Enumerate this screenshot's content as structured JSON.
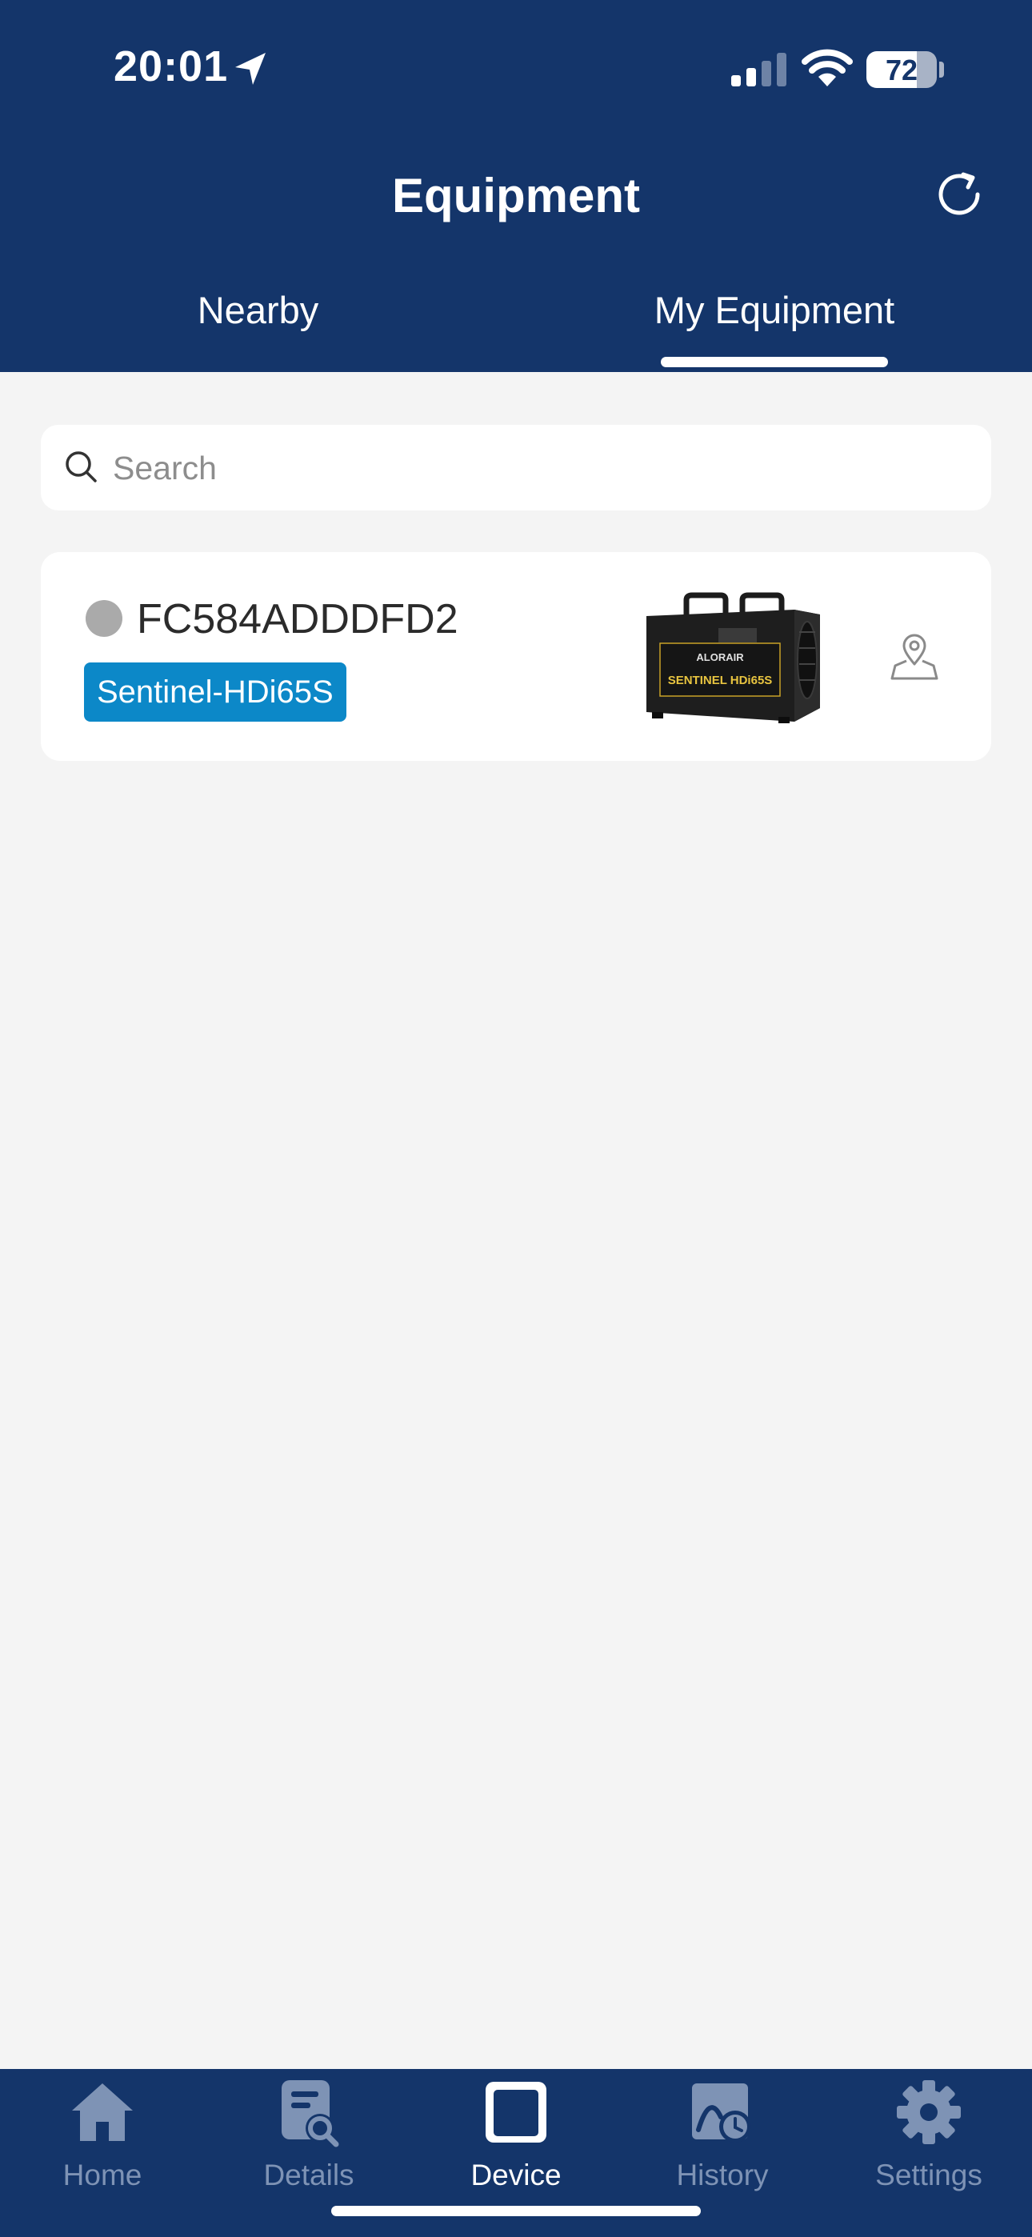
{
  "status_bar": {
    "time": "20:01",
    "battery": "72",
    "battery_level": 0.72,
    "icons": [
      "location-arrow-icon",
      "cellular-signal-icon",
      "wifi-icon",
      "battery-icon"
    ]
  },
  "header": {
    "title": "Equipment",
    "refresh_icon": "refresh-icon",
    "background": "#14356a"
  },
  "tabs": [
    {
      "label": "Nearby",
      "active": false
    },
    {
      "label": "My Equipment",
      "active": true
    }
  ],
  "search": {
    "placeholder": "Search",
    "value": ""
  },
  "devices": [
    {
      "id": "FC584ADDDFD2",
      "model": "Sentinel-HDi65S",
      "status_color": "#aaaaaa",
      "image_brand": "ALORAIR",
      "image_label": "SENTINEL HDi65S",
      "location_icon": "map-pin-icon"
    }
  ],
  "tab_bar": {
    "items": [
      {
        "label": "Home",
        "icon": "home-icon",
        "active": false
      },
      {
        "label": "Details",
        "icon": "details-search-icon",
        "active": false
      },
      {
        "label": "Device",
        "icon": "device-icon",
        "active": true
      },
      {
        "label": "History",
        "icon": "history-chart-icon",
        "active": false
      },
      {
        "label": "Settings",
        "icon": "gear-icon",
        "active": false
      }
    ]
  },
  "colors": {
    "primary": "#14356a",
    "badge": "#0c88c8",
    "page_bg": "#f4f4f4",
    "inactive_tab": "#7e93b5"
  }
}
